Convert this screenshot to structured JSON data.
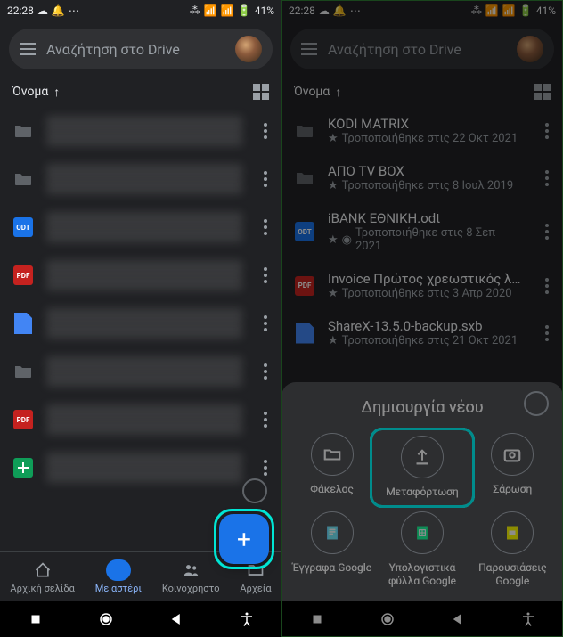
{
  "status": {
    "time": "22:28",
    "battery": "41%"
  },
  "search": {
    "placeholder": "Αναζήτηση στο Drive"
  },
  "sort": {
    "label": "Όνομα",
    "arrow": "↑"
  },
  "left_files": [
    {
      "type": "folder",
      "name": "K████████",
      "meta": "████████"
    },
    {
      "type": "folder",
      "name": "A████████",
      "meta": "████████"
    },
    {
      "type": "odt",
      "name": "i████████",
      "meta": "████████"
    },
    {
      "type": "pdf",
      "name": "████████",
      "meta": "████████"
    },
    {
      "type": "doc",
      "name": "S████████",
      "meta": "████████"
    },
    {
      "type": "folder",
      "name": "████████",
      "meta": "████████"
    },
    {
      "type": "pdf",
      "name": "████████",
      "meta": "████████"
    },
    {
      "type": "sheet",
      "name": "████████",
      "meta": "████████"
    }
  ],
  "right_files": [
    {
      "type": "folder",
      "name": "KODI MATRIX",
      "meta": "Τροποποιήθηκε στις 22 Οκτ 2021",
      "starred": true
    },
    {
      "type": "folder",
      "name": "ΑΠΟ TV BOX",
      "meta": "Τροποποιήθηκε στις 8 Ιουλ 2019",
      "starred": true
    },
    {
      "type": "odt",
      "name": "iBANK ΕΘΝΙΚΗ.odt",
      "meta": "Τροποποιήθηκε στις 8 Σεπ 2021",
      "starred": true,
      "offline": true
    },
    {
      "type": "pdf",
      "name": "Invoice Πρώτος χρεωστικός λογα...",
      "meta": "Τροποποιήθηκε στις 3 Απρ 2020",
      "starred": true
    },
    {
      "type": "doc",
      "name": "ShareX-13.5.0-backup.sxb",
      "meta": "Τροποποιήθηκε στις 21 Οκτ 2021",
      "starred": true
    }
  ],
  "nav": {
    "home": "Αρχική σελίδα",
    "starred": "Με αστέρι",
    "shared": "Κοινόχρηστο",
    "files": "Αρχεία"
  },
  "create": {
    "title": "Δημιουργία νέου",
    "folder": "Φάκελος",
    "upload": "Μεταφόρτωση",
    "scan": "Σάρωση",
    "docs": "Έγγραφα Google",
    "sheets": "Υπολογιστικά φύλλα Google",
    "slides": "Παρουσιάσεις Google"
  },
  "icons": {
    "odt": "ODT",
    "pdf": "PDF"
  }
}
